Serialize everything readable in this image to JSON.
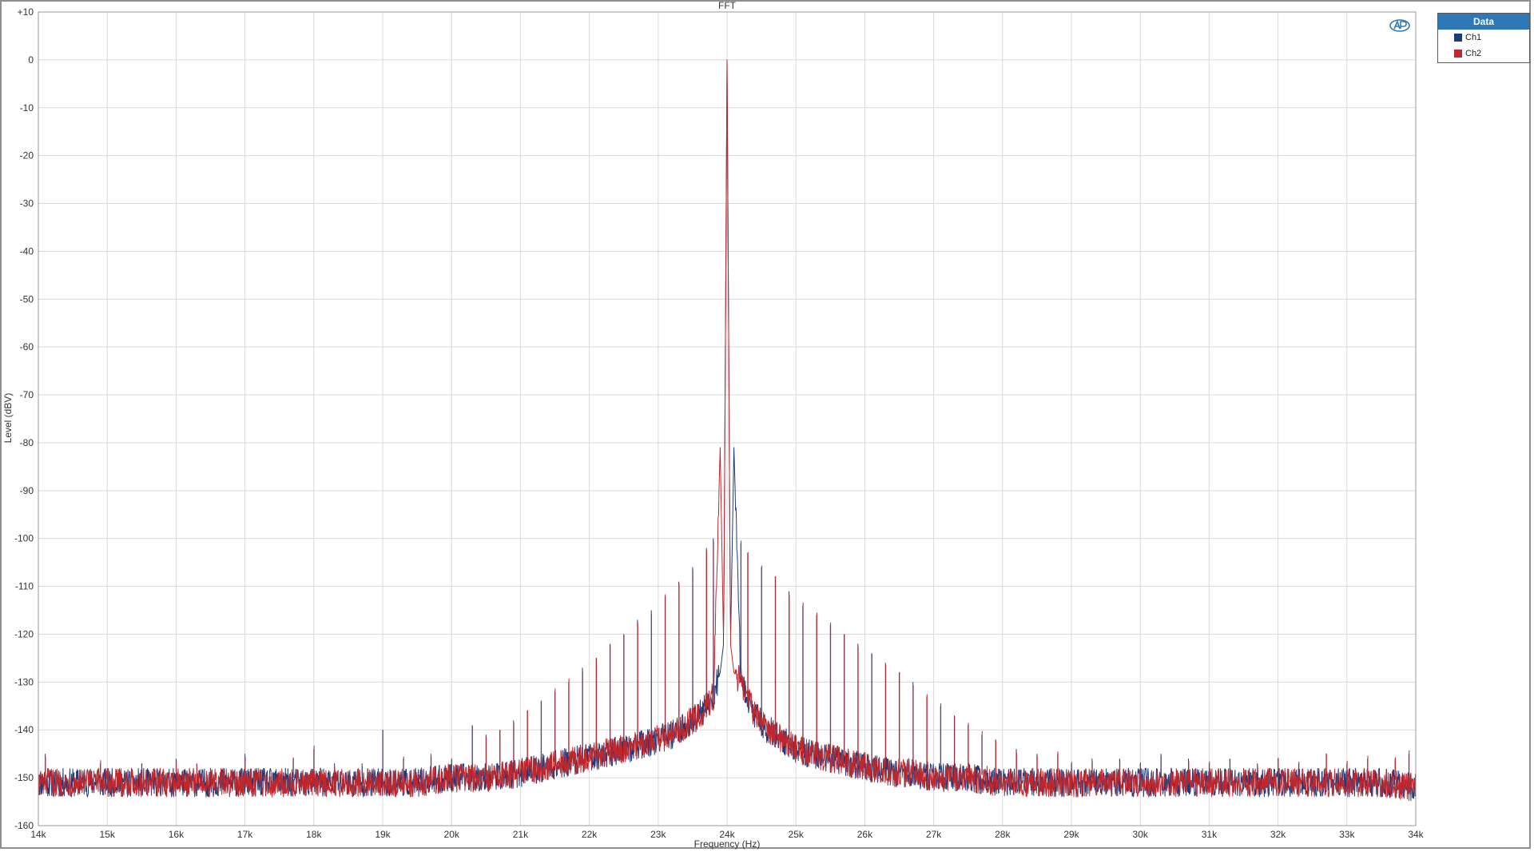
{
  "chart_data": {
    "type": "line",
    "title": "FFT",
    "xlabel": "Frequency (Hz)",
    "ylabel": "Level (dBV)",
    "xlim": [
      14000,
      34000
    ],
    "ylim": [
      -160,
      10
    ],
    "xscale": "linear",
    "grid": true,
    "xticks": [
      {
        "value": 14000,
        "label": "14k"
      },
      {
        "value": 15000,
        "label": "15k"
      },
      {
        "value": 16000,
        "label": "16k"
      },
      {
        "value": 17000,
        "label": "17k"
      },
      {
        "value": 18000,
        "label": "18k"
      },
      {
        "value": 19000,
        "label": "19k"
      },
      {
        "value": 20000,
        "label": "20k"
      },
      {
        "value": 21000,
        "label": "21k"
      },
      {
        "value": 22000,
        "label": "22k"
      },
      {
        "value": 23000,
        "label": "23k"
      },
      {
        "value": 24000,
        "label": "24k"
      },
      {
        "value": 25000,
        "label": "25k"
      },
      {
        "value": 26000,
        "label": "26k"
      },
      {
        "value": 27000,
        "label": "27k"
      },
      {
        "value": 28000,
        "label": "28k"
      },
      {
        "value": 29000,
        "label": "29k"
      },
      {
        "value": 30000,
        "label": "30k"
      },
      {
        "value": 31000,
        "label": "31k"
      },
      {
        "value": 32000,
        "label": "32k"
      },
      {
        "value": 33000,
        "label": "33k"
      },
      {
        "value": 34000,
        "label": "34k"
      }
    ],
    "yticks": [
      {
        "value": 10,
        "label": "+10"
      },
      {
        "value": 0,
        "label": "0"
      },
      {
        "value": -10,
        "label": "-10"
      },
      {
        "value": -20,
        "label": "-20"
      },
      {
        "value": -30,
        "label": "-30"
      },
      {
        "value": -40,
        "label": "-40"
      },
      {
        "value": -50,
        "label": "-50"
      },
      {
        "value": -60,
        "label": "-60"
      },
      {
        "value": -70,
        "label": "-70"
      },
      {
        "value": -80,
        "label": "-80"
      },
      {
        "value": -90,
        "label": "-90"
      },
      {
        "value": -100,
        "label": "-100"
      },
      {
        "value": -110,
        "label": "-110"
      },
      {
        "value": -120,
        "label": "-120"
      },
      {
        "value": -130,
        "label": "-130"
      },
      {
        "value": -140,
        "label": "-140"
      },
      {
        "value": -150,
        "label": "-150"
      },
      {
        "value": -160,
        "label": "-160"
      }
    ],
    "legend_title": "Data",
    "legend_position": "top-right-outside",
    "series": [
      {
        "name": "Ch1",
        "color": "#1f3a7a",
        "x": [
          14000,
          14500,
          15000,
          15500,
          16000,
          16500,
          17000,
          17500,
          18000,
          18500,
          19000,
          19500,
          20000,
          20500,
          21000,
          21300,
          21600,
          21900,
          22200,
          22500,
          22800,
          23000,
          23200,
          23400,
          23600,
          23800,
          23900,
          23950,
          24000,
          24050,
          24100,
          24200,
          24400,
          24600,
          24800,
          25000,
          25200,
          25500,
          25800,
          26100,
          26400,
          26700,
          27000,
          27500,
          28000,
          28500,
          29000,
          29500,
          30000,
          30500,
          31000,
          31500,
          32000,
          32500,
          33000,
          33500,
          34000
        ],
        "y": [
          -151,
          -151,
          -151,
          -151,
          -151,
          -151,
          -151,
          -151,
          -151,
          -151,
          -151,
          -151,
          -150,
          -150,
          -149,
          -148,
          -147,
          -146,
          -145,
          -144,
          -143,
          -142,
          -141,
          -139,
          -137,
          -133,
          -128,
          -122,
          0,
          -122,
          -81,
          -130,
          -137,
          -140,
          -142,
          -144,
          -145,
          -146,
          -147,
          -148,
          -149,
          -149,
          -150,
          -150,
          -151,
          -151,
          -151,
          -151,
          -151,
          -151,
          -151,
          -151,
          -151,
          -151,
          -151,
          -151,
          -152
        ]
      },
      {
        "name": "Ch2",
        "color": "#c0272d",
        "x": [
          14000,
          14500,
          15000,
          15500,
          16000,
          16500,
          17000,
          17500,
          18000,
          18500,
          19000,
          19500,
          20000,
          20500,
          21000,
          21300,
          21600,
          21900,
          22200,
          22500,
          22800,
          23000,
          23200,
          23400,
          23600,
          23800,
          23900,
          23950,
          24000,
          24050,
          24100,
          24200,
          24400,
          24600,
          24800,
          25000,
          25200,
          25500,
          25800,
          26100,
          26400,
          26700,
          27000,
          27500,
          28000,
          28500,
          29000,
          29500,
          30000,
          30500,
          31000,
          31500,
          32000,
          32500,
          33000,
          33500,
          34000
        ],
        "y": [
          -151,
          -151,
          -151,
          -151,
          -151,
          -151,
          -151,
          -151,
          -151,
          -151,
          -151,
          -151,
          -150,
          -150,
          -149,
          -148,
          -147,
          -146,
          -145,
          -144,
          -143,
          -142,
          -141,
          -139,
          -137,
          -133,
          -81,
          -122,
          0,
          -122,
          -128,
          -130,
          -137,
          -140,
          -142,
          -144,
          -145,
          -146,
          -147,
          -148,
          -149,
          -149,
          -150,
          -150,
          -151,
          -151,
          -151,
          -151,
          -151,
          -151,
          -151,
          -151,
          -151,
          -151,
          -151,
          -151,
          -152
        ]
      }
    ],
    "spurs": {
      "x": [
        14100,
        14900,
        15500,
        16000,
        16300,
        16700,
        17000,
        17700,
        18000,
        18300,
        18700,
        19000,
        19300,
        19700,
        20000,
        20300,
        20500,
        20700,
        20900,
        21100,
        21300,
        21500,
        21700,
        21900,
        22100,
        22300,
        22500,
        22700,
        22900,
        23100,
        23300,
        23500,
        23700,
        23800,
        24200,
        24300,
        24500,
        24700,
        24900,
        25100,
        25300,
        25500,
        25700,
        25900,
        26100,
        26300,
        26500,
        26700,
        26900,
        27100,
        27300,
        27500,
        27700,
        27900,
        28200,
        28500,
        28800,
        29000,
        29300,
        29700,
        30000,
        30300,
        30700,
        31000,
        31300,
        31700,
        32000,
        32300,
        32700,
        33000,
        33300,
        33700,
        33900
      ],
      "y": [
        -145,
        -147,
        -147,
        -146,
        -147,
        -148,
        -145,
        -146,
        -144,
        -147,
        -147,
        -140,
        -146,
        -145,
        -146,
        -139,
        -141,
        -140,
        -138,
        -136,
        -134,
        -132,
        -130,
        -127,
        -125,
        -122,
        -120,
        -117,
        -115,
        -112,
        -109,
        -106,
        -102,
        -100,
        -101,
        -103,
        -106,
        -108,
        -111,
        -114,
        -116,
        -118,
        -120,
        -122,
        -124,
        -126,
        -128,
        -130,
        -133,
        -135,
        -137,
        -139,
        -141,
        -142,
        -144,
        -145,
        -145,
        -147,
        -146,
        -146,
        -147,
        -145,
        -146,
        -147,
        -146,
        -147,
        -146,
        -147,
        -145,
        -147,
        -146,
        -146,
        -145
      ]
    }
  }
}
